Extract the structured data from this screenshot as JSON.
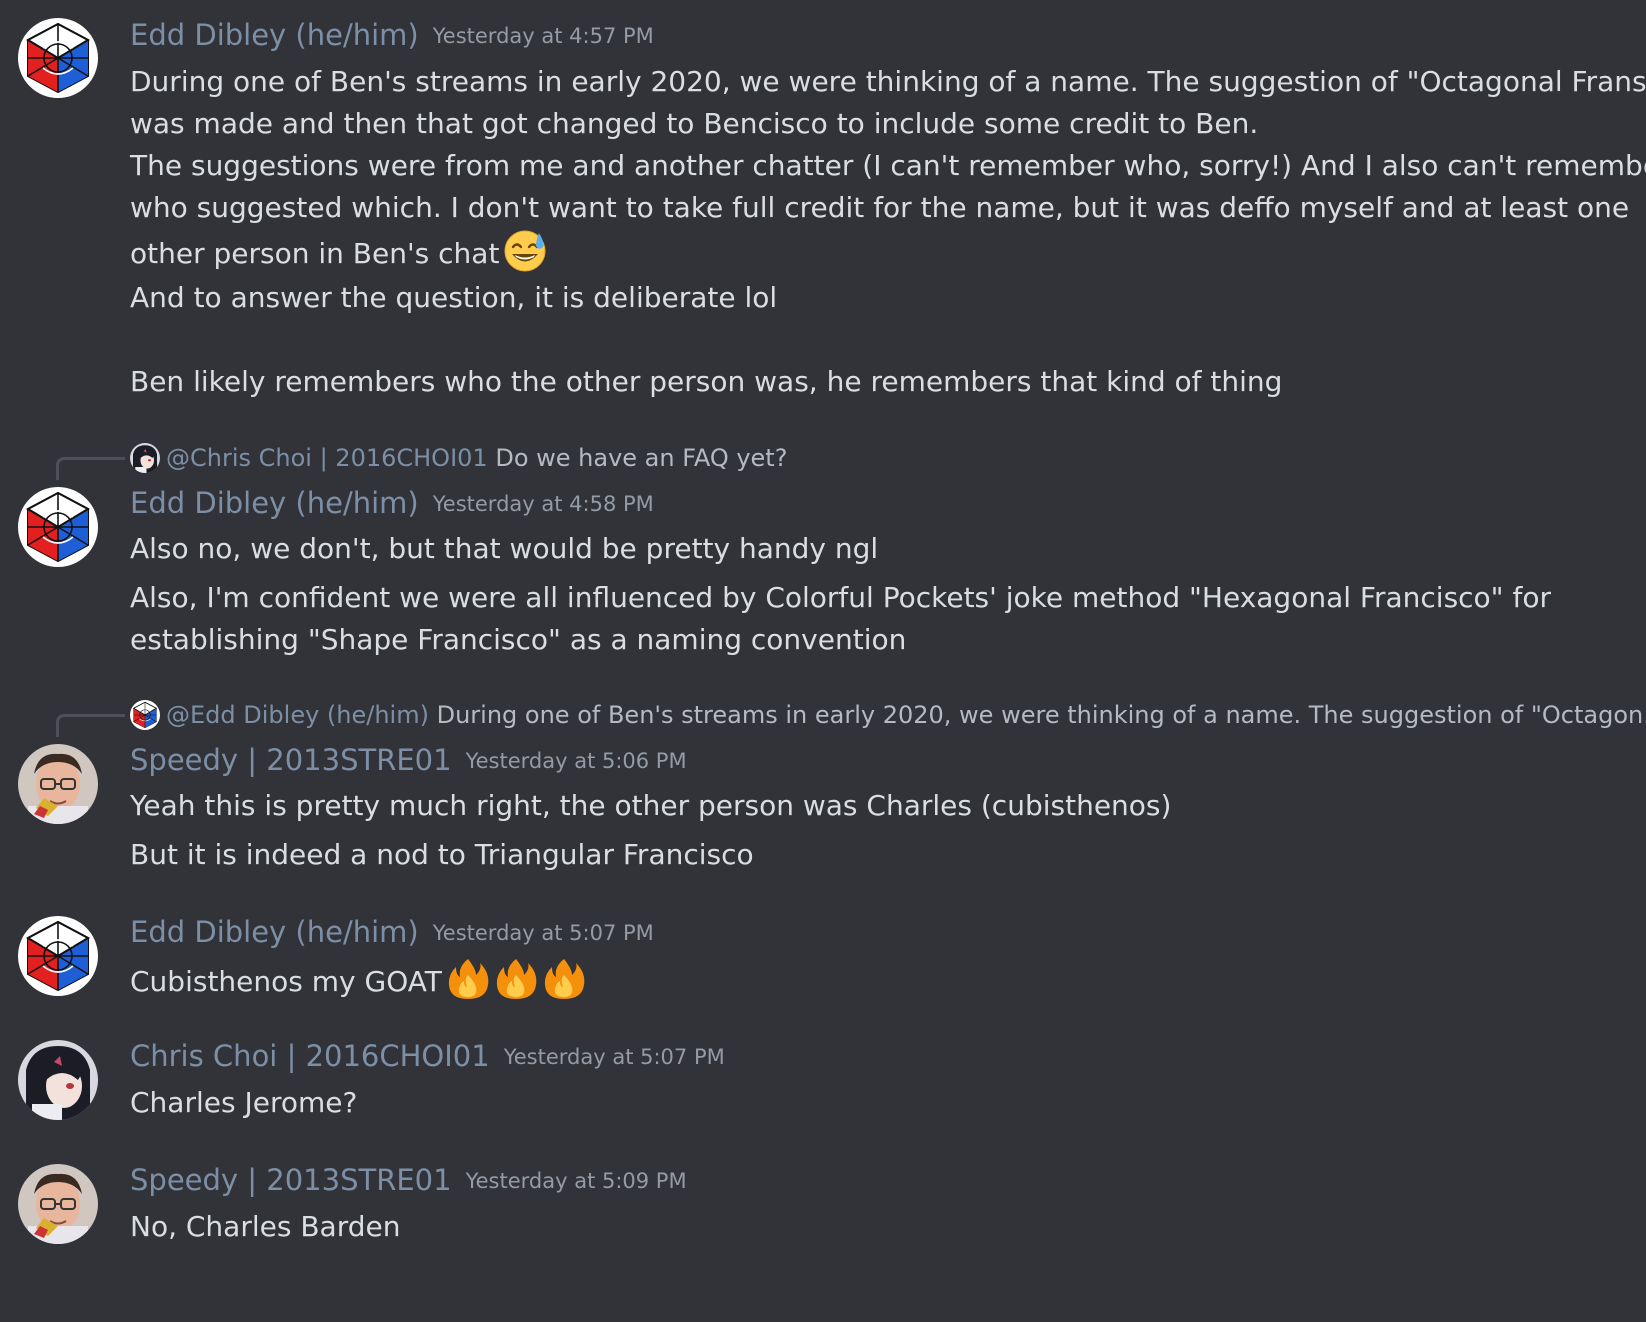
{
  "messages": [
    {
      "author": "Edd Dibley (he/him)",
      "timestamp": "Yesterday at 4:57 PM",
      "lines": [
        "During one of Ben's streams in early 2020, we were thinking of a name. The suggestion of \"Octagonal Fransisco\"",
        "was made and then that got changed to Bencisco to include some credit to Ben.",
        "The suggestions were from me and another chatter (I can't remember who, sorry!) And I also can't remember",
        "who suggested which. I don't want to take full credit for the name, but it was deffo myself and at least one",
        "other person in Ben's chat",
        "And to answer the question, it is deliberate lol",
        "Ben likely remembers who the other person was, he remembers that kind of thing"
      ],
      "emoji": "sweat-smile-emoji"
    },
    {
      "reply_to": {
        "author": "@Chris Choi | 2016CHOI01",
        "text": "Do we have an FAQ yet?"
      },
      "author": "Edd Dibley (he/him)",
      "timestamp": "Yesterday at 4:58 PM",
      "lines": [
        "Also no, we don't, but that would be pretty handy ngl",
        "Also, I'm confident we were all influenced by Colorful Pockets' joke method \"Hexagonal Francisco\" for",
        "establishing \"Shape Francisco\" as a naming convention"
      ]
    },
    {
      "reply_to": {
        "author": "@Edd Dibley (he/him)",
        "text": "During one of Ben's streams in early 2020, we were thinking of a name. The suggestion of \"Octagon..."
      },
      "author": "Speedy | 2013STRE01",
      "timestamp": "Yesterday at 5:06 PM",
      "lines": [
        "Yeah this is pretty much right, the other person was Charles (cubisthenos)",
        "But it is indeed a nod to Triangular Francisco"
      ]
    },
    {
      "author": "Edd Dibley (he/him)",
      "timestamp": "Yesterday at 5:07 PM",
      "lines": [
        "Cubisthenos my GOAT"
      ],
      "emoji": "fire-emoji"
    },
    {
      "author": "Chris Choi | 2016CHOI01",
      "timestamp": "Yesterday at 5:07 PM",
      "lines": [
        "Charles Jerome?"
      ]
    },
    {
      "author": "Speedy | 2013STRE01",
      "timestamp": "Yesterday at 5:09 PM",
      "lines": [
        "No, Charles Barden"
      ]
    }
  ],
  "colors": {
    "background": "#313338",
    "username": "#7d8fa6",
    "timestamp": "#949ba4",
    "text": "#dbdee1"
  }
}
